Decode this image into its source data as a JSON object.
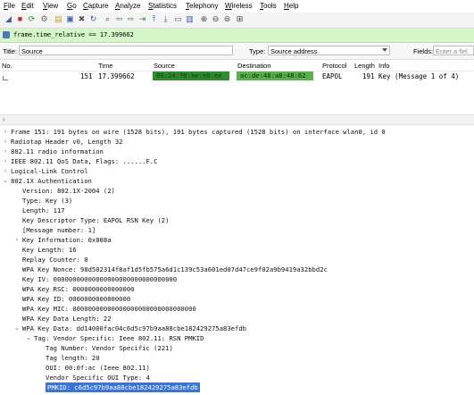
{
  "menu": [
    "File",
    "Edit",
    "View",
    "Go",
    "Capture",
    "Analyze",
    "Statistics",
    "Telephony",
    "Wireless",
    "Tools",
    "Help"
  ],
  "toolbar_icons": [
    "shark-fin-icon",
    "stop-icon",
    "restart-icon",
    "options-icon",
    "open-icon",
    "save-icon",
    "close-file-icon",
    "reload-icon",
    "find-icon",
    "back-icon",
    "forward-icon",
    "goto-icon",
    "first-icon",
    "last-icon",
    "autoscroll-icon",
    "colorize-icon",
    "zoom-in-icon",
    "zoom-out-icon",
    "zoom-reset-icon",
    "resize-columns-icon"
  ],
  "display_filter": "frame.time_relative == 17.399662",
  "search": {
    "title_label": "Title:",
    "source_value": "Source",
    "type_label": "Type:",
    "type_value": "Source address",
    "fields_label": "Fields:",
    "fields_placeholder": "Enter a fiel"
  },
  "packet_columns": [
    "No.",
    "Time",
    "Source",
    "Destination",
    "Protocol",
    "Length",
    "Info"
  ],
  "packet_row": {
    "no": "151",
    "time": "17.399662",
    "source": "00:24:78:be:e0:ee",
    "destination": "ac:de:48:a8:48:62",
    "protocol": "EAPOL",
    "length": "191",
    "info": "Key (Message 1 of 4)"
  },
  "details": [
    {
      "indent": 0,
      "tw": ">",
      "text": "Frame 151: 191 bytes on wire (1528 bits), 191 bytes captured (1528 bits) on interface wlan0, id 0"
    },
    {
      "indent": 0,
      "tw": ">",
      "text": "Radiotap Header v0, Length 32"
    },
    {
      "indent": 0,
      "tw": ">",
      "text": "802.11 radio information"
    },
    {
      "indent": 0,
      "tw": ">",
      "text": "IEEE 802.11 QoS Data, Flags: ......F.C"
    },
    {
      "indent": 0,
      "tw": ">",
      "text": "Logical-Link Control"
    },
    {
      "indent": 0,
      "tw": "v",
      "text": "802.1X Authentication"
    },
    {
      "indent": 1,
      "tw": "",
      "text": "Version: 802.1X-2004 (2)"
    },
    {
      "indent": 1,
      "tw": "",
      "text": "Type: Key (3)"
    },
    {
      "indent": 1,
      "tw": "",
      "text": "Length: 117"
    },
    {
      "indent": 1,
      "tw": "",
      "text": "Key Descriptor Type: EAPOL RSN Key (2)"
    },
    {
      "indent": 1,
      "tw": "",
      "text": "[Message number: 1]"
    },
    {
      "indent": 1,
      "tw": ">",
      "text": "Key Information: 0x008a"
    },
    {
      "indent": 1,
      "tw": "",
      "text": "Key Length: 16"
    },
    {
      "indent": 1,
      "tw": "",
      "text": "Replay Counter: 0"
    },
    {
      "indent": 1,
      "tw": "",
      "text": "WPA Key Nonce: 98d502314f8af1d5fb575a6d1c139c53a601ed07d47ce9f02a9b9419a32bbd2c"
    },
    {
      "indent": 1,
      "tw": "",
      "text": "Key IV: 00000000000000000000000000000000"
    },
    {
      "indent": 1,
      "tw": "",
      "text": "WPA Key RSC: 0000000000000000"
    },
    {
      "indent": 1,
      "tw": "",
      "text": "WPA Key ID: 0000000000000000"
    },
    {
      "indent": 1,
      "tw": "",
      "text": "WPA Key MIC: 00000000000000000000000000000000"
    },
    {
      "indent": 1,
      "tw": "",
      "text": "WPA Key Data Length: 22"
    },
    {
      "indent": 1,
      "tw": "v",
      "text": "WPA Key Data: dd14000fac04c6d5c97b9aa88cbe182429275a83efdb"
    },
    {
      "indent": 2,
      "tw": "v",
      "text": "Tag: Vendor Specific: Ieee 802.11: RSN PMKID"
    },
    {
      "indent": 3,
      "tw": "",
      "text": "Tag Number: Vendor Specific (221)"
    },
    {
      "indent": 3,
      "tw": "",
      "text": "Tag length: 20"
    },
    {
      "indent": 3,
      "tw": "",
      "text": "OUI: 00:0f:ac (Ieee 802.11)"
    },
    {
      "indent": 3,
      "tw": "",
      "text": "Vendor Specific OUI Type: 4"
    },
    {
      "indent": 3,
      "tw": "",
      "text": "PMKID: c6d5c97b9aa88cbe182429275a83efdb",
      "selected": true
    }
  ],
  "colors": {
    "filter_bg": "#d6f5c8",
    "mac_green": "#3f9a36",
    "selection": "#3b73d6"
  }
}
